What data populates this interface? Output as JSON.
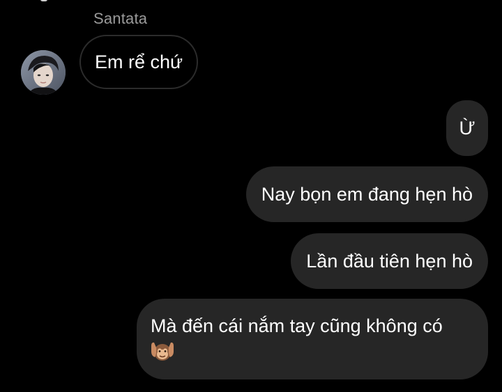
{
  "chat": {
    "sender_name": "Santata",
    "incoming": [
      {
        "text": "Em rể chứ"
      }
    ],
    "outgoing": [
      {
        "text": "Ừ"
      },
      {
        "text": "Nay bọn em đang hẹn hò"
      },
      {
        "text": "Lần đầu tiên hẹn hò"
      },
      {
        "text": "Mà đến cái nắm tay cũng không có"
      }
    ],
    "emoji": "monkey-covering-ears-emoji"
  },
  "colors": {
    "background": "#000000",
    "outgoing_bubble": "#262626",
    "incoming_bubble_border": "#2c2c2c",
    "sender_name": "#9a9a9a",
    "text": "#ffffff"
  }
}
